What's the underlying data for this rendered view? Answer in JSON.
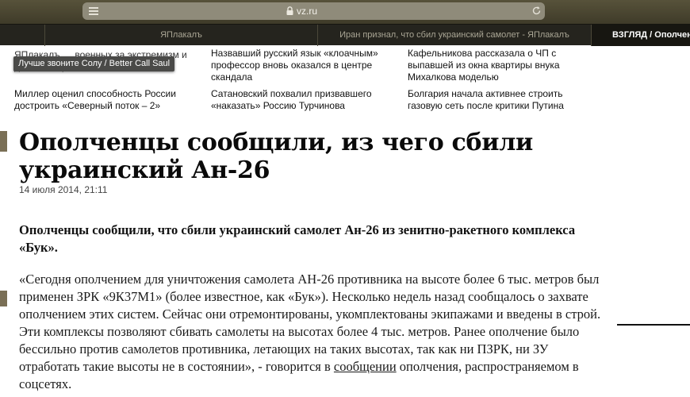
{
  "browser": {
    "url": "vz.ru",
    "tabs": [
      {
        "label": ""
      },
      {
        "label": "ЯПлакалъ"
      },
      {
        "label": "Иран признал, что сбил украинский самолет - ЯПлакалъ"
      },
      {
        "label": "ВЗГЛЯД / Ополчен"
      }
    ]
  },
  "top_news": [
    {
      "text": "ЯПлакалъ … военных за экстремизм и детское порно"
    },
    {
      "text": "Назвавший русский язык «клоачным» профессор вновь оказался в центре скандала"
    },
    {
      "text": "Кафельникова рассказала о ЧП с выпавшей из окна квартиры внука Михалкова моделью"
    },
    {
      "text": "Миллер оценил способность России достроить «Северный поток – 2»"
    },
    {
      "text": "Сатановский похвалил призвавшего «наказать» Россию Турчинова"
    },
    {
      "text": "Болгария начала активнее строить газовую сеть после критики Путина"
    }
  ],
  "tooltip": {
    "text": "Лучше звоните Солу / Better Call Saul"
  },
  "article": {
    "headline": "Ополченцы сообщили, из чего сбили украинский Ан-26",
    "date": "14 июля 2014, 21:11",
    "lead": "Ополченцы сообщили, что сбили украинский самолет Ан-26 из зенитно-ракетного комплекса «Бук».",
    "body_before_link": "«Сегодня ополчением для уничтожения самолета АН-26 противника на высоте более 6 тыс. метров был применен ЗРК «9К37М1» (более известное, как «Бук»). Несколько недель назад сообщалось о захвате ополчением этих систем. Сейчас они отремонтированы, укомплектованы экипажами и введены в строй. Эти комплексы позволяют сбивать самолеты на высотах более 4 тыс. метров. Ранее ополчение было бессильно против самолетов противника, летающих на таких высотах, так как ни ПЗРК, ни ЗУ отработать такие высоты не в состоянии», - говорится в ",
    "link_text": "сообщении",
    "body_after_link": " ополчения, распространяемом в соцсетях."
  },
  "colors": {
    "chrome": "#4a4632",
    "tab_strip": "#25241e",
    "accent": "#7a6f56"
  }
}
